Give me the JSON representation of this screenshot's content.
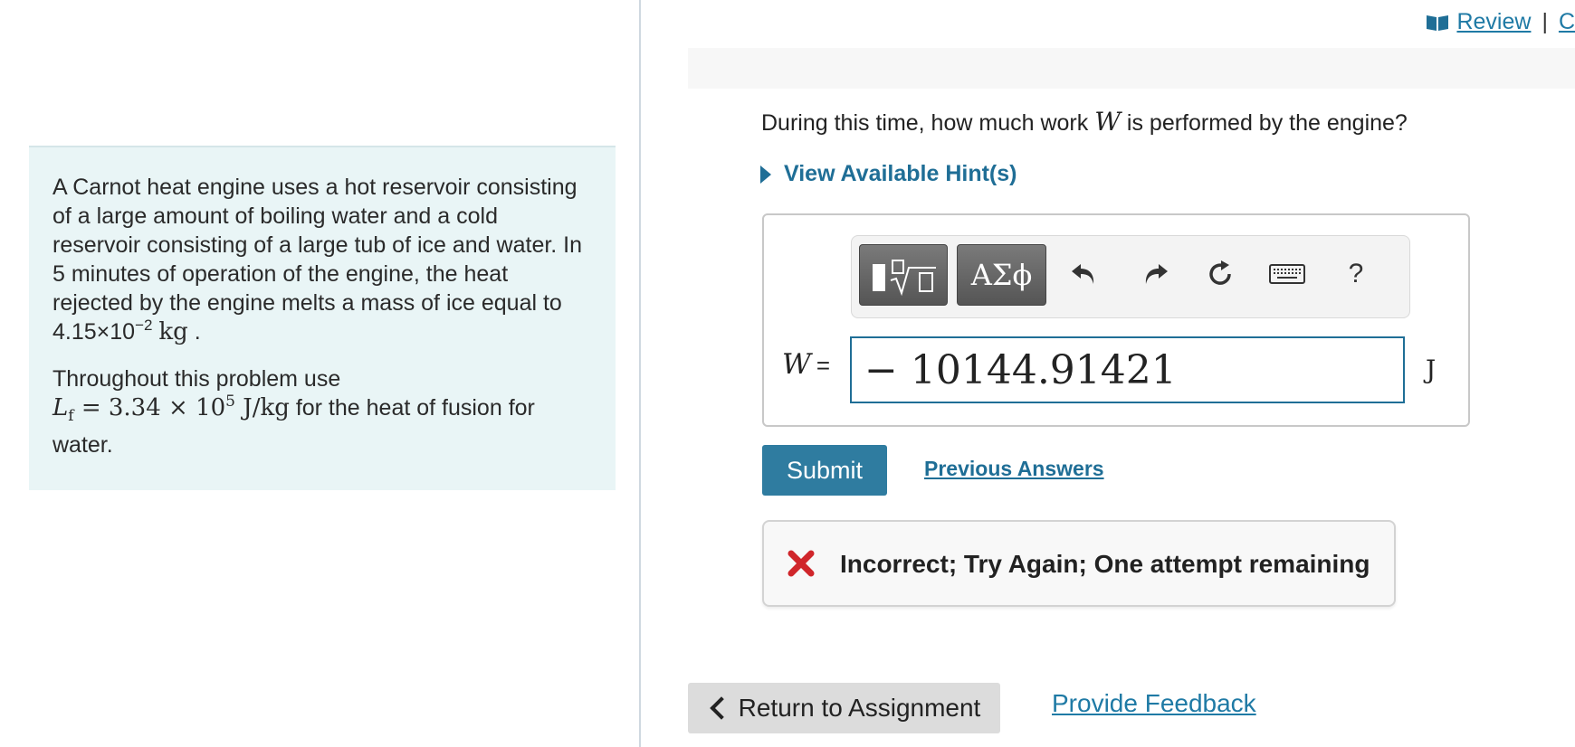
{
  "header": {
    "review_label": "Review",
    "separator": "|",
    "next_label": "C"
  },
  "problem": {
    "text_1": "A Carnot heat engine uses a hot reservoir consisting of a large amount of boiling water and a cold reservoir consisting of a large tub of ice and water. In 5 minutes of operation of the engine, the heat rejected by the engine melts a mass of ice equal to",
    "mass_value": "4.15×10",
    "mass_exp": "−2",
    "mass_unit": "kg",
    "period": ".",
    "text_2": "Throughout this problem use",
    "lf_symbol": "L",
    "lf_sub": "f",
    "lf_value": "= 3.34 × 10",
    "lf_exp": "5",
    "lf_unit": "J/kg",
    "text_3": "for the heat of fusion for water."
  },
  "question": {
    "prefix": "During this time, how much work",
    "variable": "W",
    "suffix": "is performed by the engine?"
  },
  "hint": {
    "label": "View Available Hint(s)"
  },
  "toolbar": {
    "greek_label": "ΑΣϕ",
    "help_label": "?"
  },
  "answer": {
    "variable": "W",
    "equals": "=",
    "value": "− 10144.91421",
    "unit": "J"
  },
  "actions": {
    "submit_label": "Submit",
    "previous_answers_label": "Previous Answers"
  },
  "feedback": {
    "message": "Incorrect; Try Again; One attempt remaining"
  },
  "footer": {
    "return_label": "Return to Assignment",
    "feedback_label": "Provide Feedback"
  },
  "colors": {
    "accent": "#1f6e96",
    "submit_bg": "#2f7ca0",
    "error_red": "#d0262b",
    "problem_bg": "#e9f5f6"
  }
}
